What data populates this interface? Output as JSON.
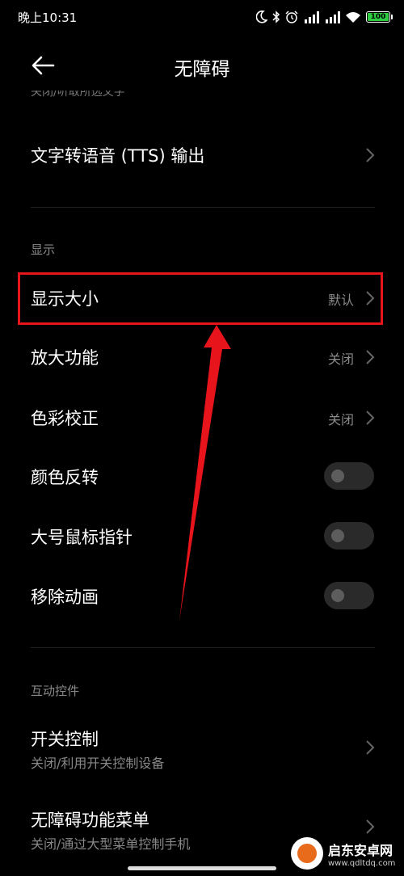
{
  "status_bar": {
    "time": "晚上10:31",
    "icons": [
      "moon-icon",
      "bluetooth-icon",
      "alarm-icon",
      "signal-icon",
      "signal-icon",
      "wifi-icon",
      "battery-icon"
    ],
    "battery_level": "100",
    "battery_color": "#2ecc40"
  },
  "header": {
    "title": "无障碍",
    "back_icon": "back-arrow-icon"
  },
  "partial_row_text": "关闭/听取所选文字",
  "tts_row": {
    "label": "文字转语音 (TTS) 输出"
  },
  "display_section": {
    "title": "显示",
    "items": [
      {
        "label": "显示大小",
        "value": "默认"
      },
      {
        "label": "放大功能",
        "value": "关闭"
      },
      {
        "label": "色彩校正",
        "value": "关闭"
      }
    ],
    "toggles": [
      {
        "label": "颜色反转",
        "state": "off"
      },
      {
        "label": "大号鼠标指针",
        "state": "off"
      },
      {
        "label": "移除动画",
        "state": "off"
      }
    ]
  },
  "interaction_section": {
    "title": "互动控件",
    "items": [
      {
        "label": "开关控制",
        "subtitle": "关闭/利用开关控制设备"
      },
      {
        "label": "无障碍功能菜单",
        "subtitle": "关闭/通过大型菜单控制手机"
      }
    ]
  },
  "annotation": {
    "highlight_color": "#e8141b"
  },
  "watermark": {
    "name": "启东安卓网",
    "url": "www.qdltdq.com"
  }
}
